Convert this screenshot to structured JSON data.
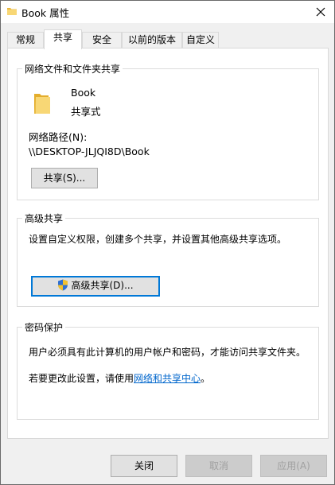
{
  "window": {
    "title": "Book 属性",
    "close_icon": "close-icon"
  },
  "tabs": [
    {
      "label": "常规"
    },
    {
      "label": "共享",
      "active": true
    },
    {
      "label": "安全"
    },
    {
      "label": "以前的版本"
    },
    {
      "label": "自定义"
    }
  ],
  "network_sharing": {
    "title": "网络文件和文件夹共享",
    "folder_name": "Book",
    "status": "共享式",
    "path_label": "网络路径(N):",
    "path_value": "\\\\DESKTOP-JLJQI8D\\Book",
    "share_button": "共享(S)..."
  },
  "advanced_sharing": {
    "title": "高级共享",
    "description": "设置自定义权限，创建多个共享，并设置其他高级共享选项。",
    "button": "高级共享(D)..."
  },
  "password_protection": {
    "title": "密码保护",
    "line1": "用户必须具有此计算机的用户帐户和密码，才能访问共享文件夹。",
    "line2_prefix": "若要更改此设置，请使用",
    "line2_link": "网络和共享中心",
    "line2_suffix": "。"
  },
  "footer": {
    "close": "关闭",
    "cancel": "取消",
    "apply": "应用(A)"
  },
  "colors": {
    "accent": "#0078d7",
    "folder": "#f5c346",
    "link": "#0066cc"
  }
}
